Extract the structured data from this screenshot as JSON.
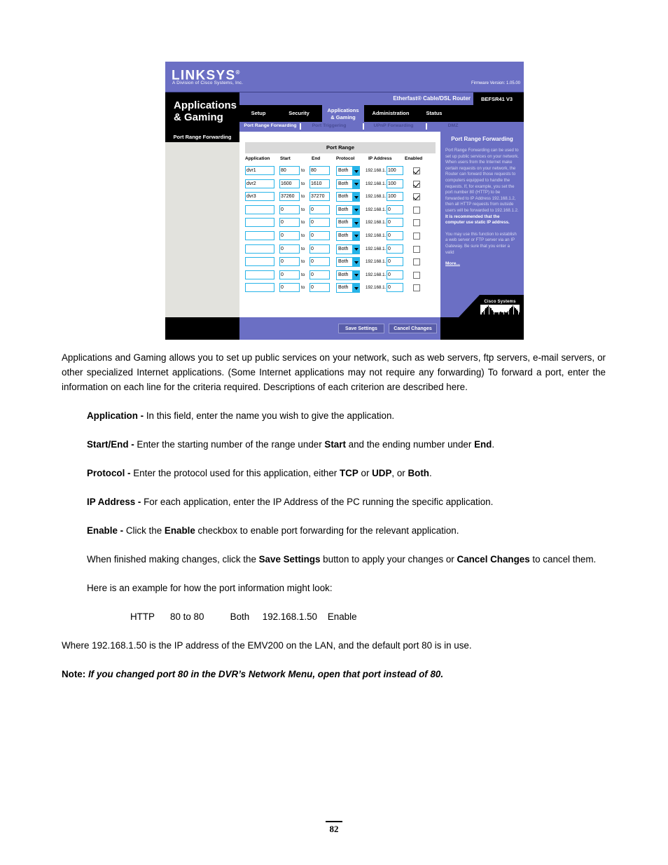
{
  "router_ui": {
    "brand": {
      "logo_text": "LINKSYS",
      "logo_reg": "®",
      "tagline": "A Division of Cisco Systems, Inc.",
      "firmware": "Firmware Version: 1.05.00"
    },
    "header": {
      "section_title_line1": "Applications",
      "section_title_line2": "& Gaming",
      "router_name": "Etherfast® Cable/DSL Router",
      "model": "BEFSR41 V3"
    },
    "tabs": [
      {
        "label": "Setup",
        "active": false
      },
      {
        "label": "Security",
        "active": false
      },
      {
        "label": "Applications\n& Gaming",
        "active": true
      },
      {
        "label": "Administration",
        "active": false
      },
      {
        "label": "Status",
        "active": false
      }
    ],
    "subtabs": [
      {
        "label": "Port Range Forwarding",
        "active": true
      },
      {
        "label": "Port Triggering",
        "active": false
      },
      {
        "label": "UPnP Forwarding",
        "active": false
      },
      {
        "label": "DMZ",
        "active": false
      }
    ],
    "left_panel": {
      "header": "Port Range Forwarding"
    },
    "table": {
      "title": "Port Range",
      "columns": [
        "Application",
        "Start",
        "End",
        "Protocol",
        "IP Address",
        "Enabled"
      ],
      "to_label": "to",
      "ip_prefix": "192.168.1.",
      "rows": [
        {
          "application": "dvr1",
          "start": "80",
          "end": "80",
          "protocol": "Both",
          "ip_last": "100",
          "enabled": true
        },
        {
          "application": "dvr2",
          "start": "1600",
          "end": "1610",
          "protocol": "Both",
          "ip_last": "100",
          "enabled": true
        },
        {
          "application": "dvr3",
          "start": "37260",
          "end": "37270",
          "protocol": "Both",
          "ip_last": "100",
          "enabled": true
        },
        {
          "application": "",
          "start": "0",
          "end": "0",
          "protocol": "Both",
          "ip_last": "0",
          "enabled": false
        },
        {
          "application": "",
          "start": "0",
          "end": "0",
          "protocol": "Both",
          "ip_last": "0",
          "enabled": false
        },
        {
          "application": "",
          "start": "0",
          "end": "0",
          "protocol": "Both",
          "ip_last": "0",
          "enabled": false
        },
        {
          "application": "",
          "start": "0",
          "end": "0",
          "protocol": "Both",
          "ip_last": "0",
          "enabled": false
        },
        {
          "application": "",
          "start": "0",
          "end": "0",
          "protocol": "Both",
          "ip_last": "0",
          "enabled": false
        },
        {
          "application": "",
          "start": "0",
          "end": "0",
          "protocol": "Both",
          "ip_last": "0",
          "enabled": false
        },
        {
          "application": "",
          "start": "0",
          "end": "0",
          "protocol": "Both",
          "ip_last": "0",
          "enabled": false
        }
      ]
    },
    "help": {
      "title": "Port Range Forwarding",
      "paragraph1_a": "Port Range Forwarding can be used to set up public services on your network. When users from the Internet make certain requests on your network, the Router can forward those requests to computers equipped to handle the requests. If, for example, you set the port number 80 (HTTP) to be forwarded to IP Address 192.168.1.2, then all HTTP requests from outside users will be forwarded to 192.168.1.2. ",
      "paragraph1_b": "It is recommended that the computer use static IP address.",
      "paragraph2": "You may use this function to establish a web server or FTP server via an IP Gateway. Be sure that you enter a valid",
      "more_link": "More...",
      "cisco_logo_text": "Cisco Systems"
    },
    "footer": {
      "save_label": "Save Settings",
      "cancel_label": "Cancel Changes"
    }
  },
  "document": {
    "intro": "Applications and Gaming allows you to set up public services on your network, such as web servers, ftp servers, e-mail servers, or other specialized Internet applications. (Some Internet applications may not require any forwarding) To forward a port, enter the information on each line for the criteria required. Descriptions of each criterion are described here.",
    "items": [
      {
        "term": "Application - ",
        "rest": "In this field, enter the name you wish to give the application."
      }
    ],
    "application_term": "Application - ",
    "application_text": "In this field, enter the name you wish to give the application.",
    "startend_term": "Start/End - ",
    "startend_p1": "Enter the starting number of the range under ",
    "startend_b1": "Start",
    "startend_p2": " and the ending number under ",
    "startend_b2": "End",
    "startend_p3": ".",
    "protocol_term": "Protocol - ",
    "protocol_p1": "Enter the protocol used for this application, either ",
    "protocol_b1": "TCP",
    "protocol_p2": " or ",
    "protocol_b2": "UDP",
    "protocol_p3": ", or ",
    "protocol_b3": "Both",
    "protocol_p4": ".",
    "ipaddress_term": "IP Address - ",
    "ipaddress_text": "For each application, enter the IP Address of the PC running the specific application.",
    "enable_term": "Enable - ",
    "enable_p1": "Click the ",
    "enable_b1": "Enable",
    "enable_p2": " checkbox to enable port forwarding for the relevant application.",
    "finish_p1": "When finished making changes, click the ",
    "finish_b1": "Save Settings",
    "finish_p2": " button to apply your changes or ",
    "finish_b2": "Cancel Changes",
    "finish_p3": " to cancel them.",
    "example_lead": "Here is an example for how the port information might look:",
    "example_row": "HTTP      80 to 80          Both     192.168.1.50    Enable",
    "where_text": "Where 192.168.1.50 is the IP address of the EMV200 on the LAN, and the default port 80 is in use.",
    "note_label": "Note: ",
    "note_text": "If you changed port 80 in the DVR’s Network Menu, open that port instead of 80."
  },
  "page": {
    "number": "82"
  }
}
